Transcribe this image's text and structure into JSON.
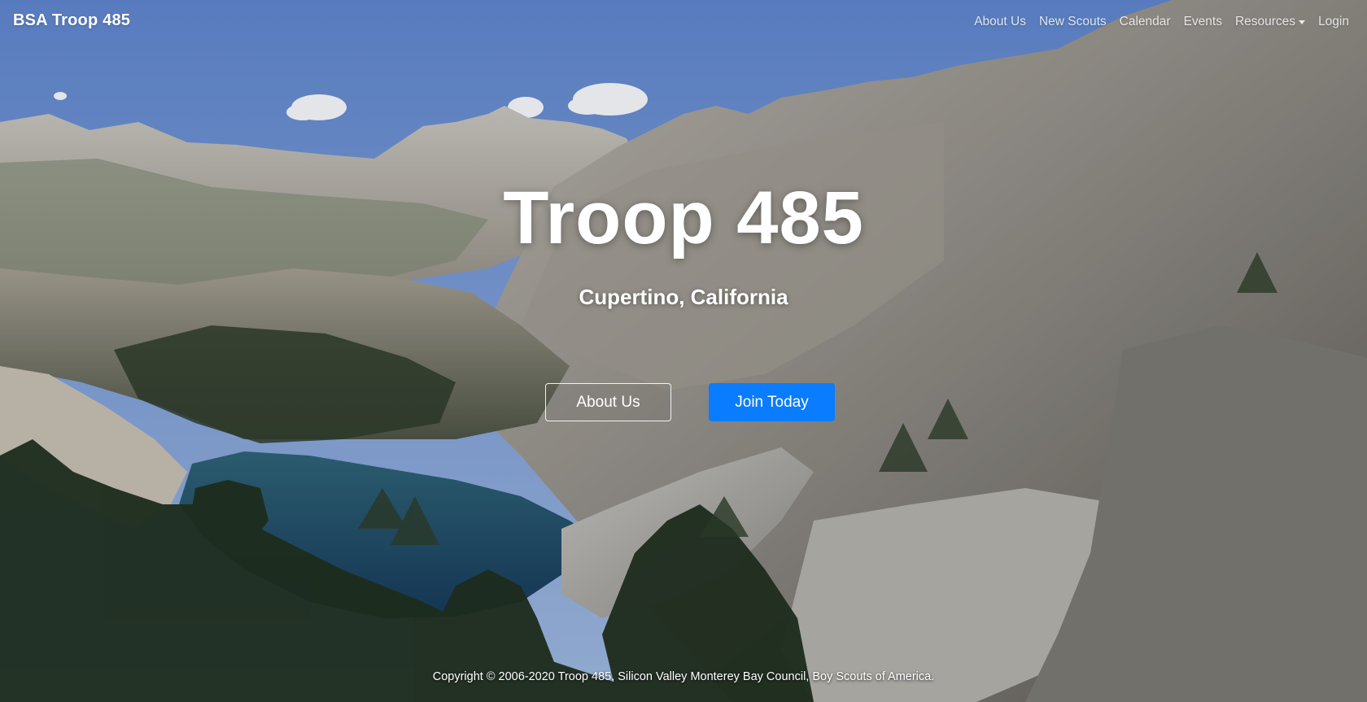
{
  "navbar": {
    "brand": "BSA Troop 485",
    "links": [
      {
        "label": "About Us"
      },
      {
        "label": "New Scouts"
      },
      {
        "label": "Calendar"
      },
      {
        "label": "Events"
      },
      {
        "label": "Resources"
      },
      {
        "label": "Login"
      }
    ]
  },
  "hero": {
    "title": "Troop 485",
    "subtitle": "Cupertino, California",
    "buttons": {
      "about": "About Us",
      "join": "Join Today"
    },
    "background": "mountain-lake-landscape"
  },
  "footer": {
    "copyright": "Copyright © 2006-2020 Troop 485, Silicon Valley Monterey Bay Council, Boy Scouts of America."
  },
  "colors": {
    "primary_button": "#0a7cff",
    "sky": "#6d8fc4",
    "text": "#ffffff"
  }
}
